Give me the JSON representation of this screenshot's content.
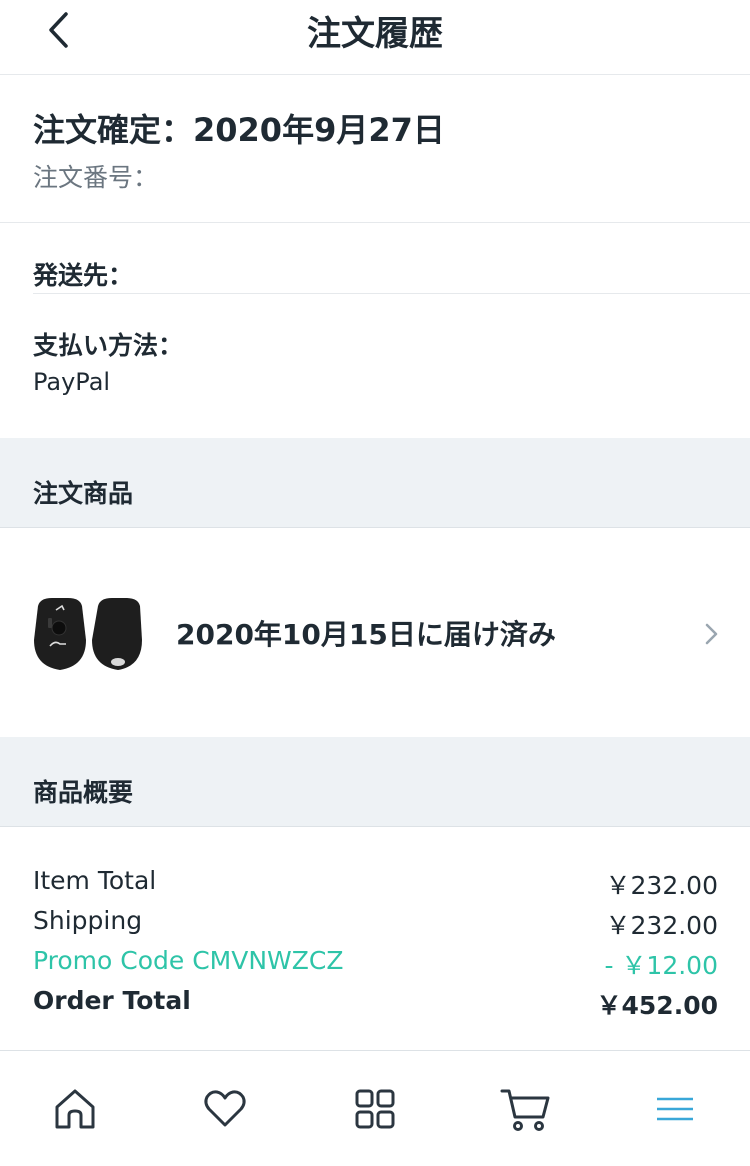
{
  "header": {
    "title": "注文履歴"
  },
  "order": {
    "confirmed": "注文確定：2020年9月27日",
    "number_label": "注文番号："
  },
  "shipping": {
    "label": "発送先："
  },
  "payment": {
    "label": "支払い方法：",
    "value": "PayPal"
  },
  "items_section": {
    "title": "注文商品"
  },
  "product": {
    "delivery_status": "2020年10月15日に届け済み",
    "thumb_icon": "car-key-cover-image"
  },
  "summary_section": {
    "title": "商品概要"
  },
  "summary": [
    {
      "label": "Item Total",
      "value": "￥232.00",
      "style": "normal"
    },
    {
      "label": "Shipping",
      "value": "￥232.00",
      "style": "normal"
    },
    {
      "label": "Promo Code CMVNWZCZ",
      "value": "- ￥12.00",
      "style": "promo"
    },
    {
      "label": "Order Total",
      "value": "￥452.00",
      "style": "total"
    }
  ],
  "colors": {
    "accent": "#2ec4a8",
    "nav_active": "#39a7d8",
    "text": "#1f2a33",
    "muted": "#6b7680",
    "section_bg": "#eef2f5"
  },
  "nav": [
    "home-icon",
    "heart-icon",
    "grid-icon",
    "cart-icon",
    "menu-icon"
  ]
}
